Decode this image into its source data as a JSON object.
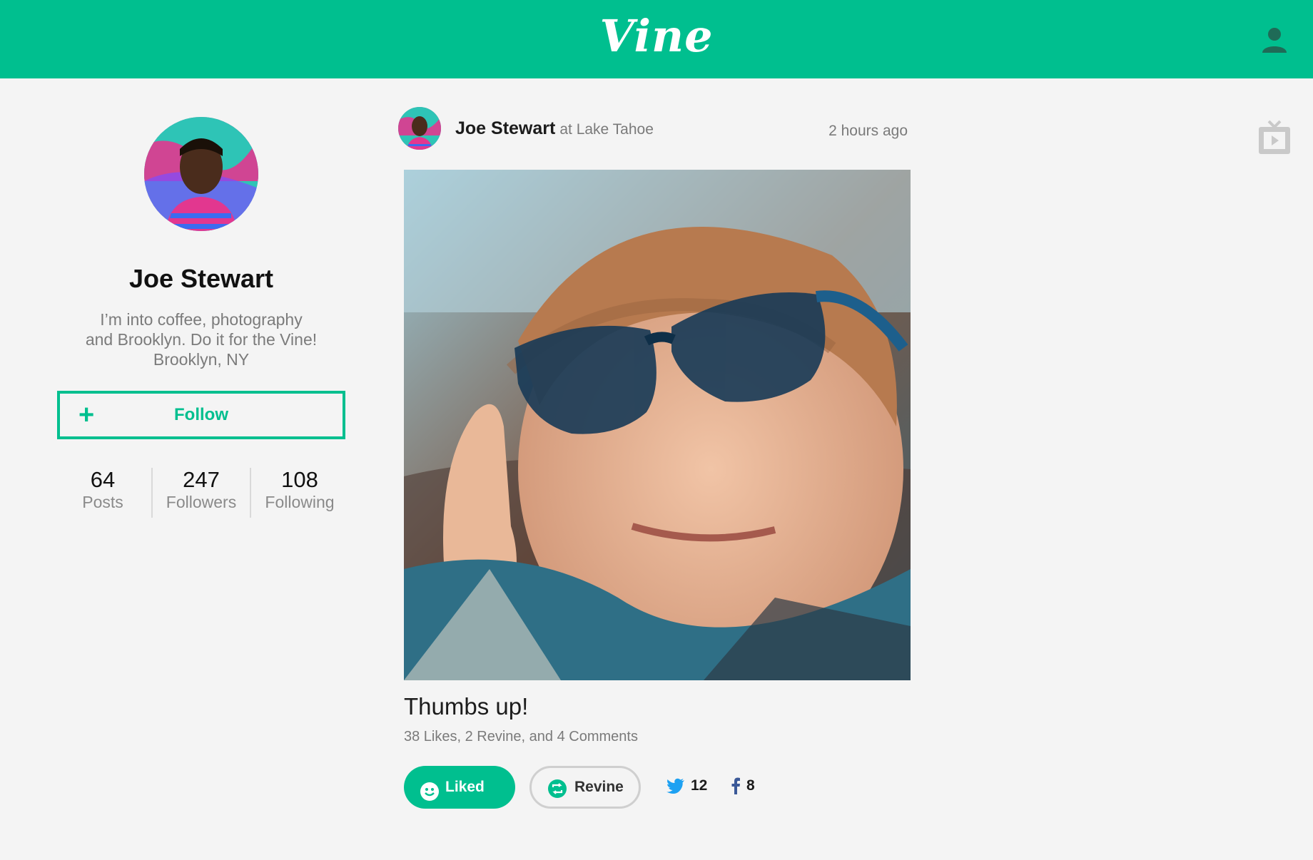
{
  "header": {
    "logo": "Vine",
    "brand_color": "#00bf8f"
  },
  "profile": {
    "name": "Joe Stewart",
    "bio_line1": "I’m into coffee, photography",
    "bio_line2": "and Brooklyn. Do it for the Vine!",
    "location": "Brooklyn, NY",
    "follow_label": "Follow",
    "stats": [
      {
        "value": "64",
        "label": "Posts"
      },
      {
        "value": "247",
        "label": "Followers"
      },
      {
        "value": "108",
        "label": "Following"
      }
    ]
  },
  "post": {
    "author": "Joe Stewart",
    "location": "at Lake Tahoe",
    "time": "2 hours ago",
    "caption": "Thumbs up!",
    "counts": "38 Likes, 2 Revine, and 4 Comments",
    "liked_label": "Liked",
    "revine_label": "Revine",
    "twitter_count": "12",
    "facebook_count": "8"
  }
}
